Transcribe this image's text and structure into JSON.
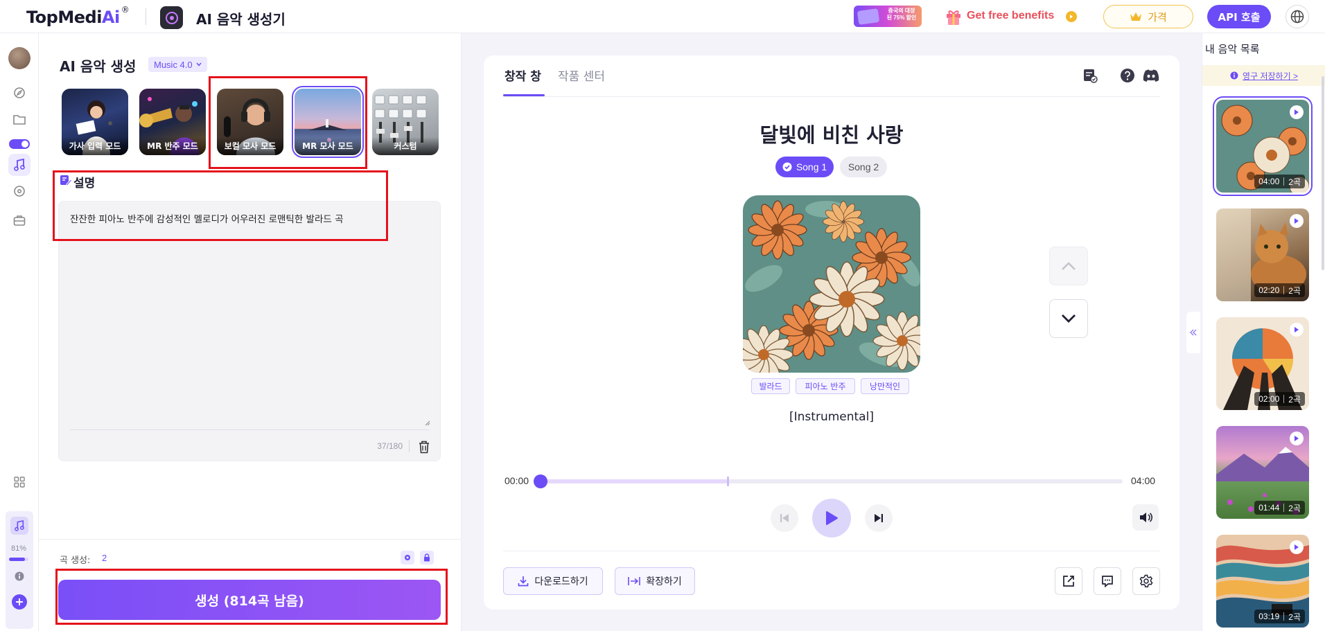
{
  "header": {
    "logo_main": "TopMedi",
    "logo_ai": "Ai",
    "logo_reg": "®",
    "app_title": "AI 음악 생성기",
    "promo_text": "중국의 대장된 75% 할인",
    "free_benefits": "Get free benefits",
    "price_label": "가격",
    "api_label": "API 호출"
  },
  "rail": {
    "percent": "81%"
  },
  "left_panel": {
    "title": "AI 음악 생성",
    "version": "Music 4.0",
    "modes": [
      {
        "label": "가사 입력 모드"
      },
      {
        "label": "MR 반주 모드"
      },
      {
        "label": "보컬 모사 모드"
      },
      {
        "label": "MR 모사 모드"
      },
      {
        "label": "커스텀"
      }
    ],
    "description_title": "설명",
    "description_text": "잔잔한 피아노 반주에 감성적인 멜로디가 어우러진 로맨틱한 발라드 곡",
    "char_count": "37/180",
    "song_count_label": "곡 생성:",
    "song_count_value": "2",
    "generate_label": "생성 (814곡 남음)"
  },
  "player": {
    "tabs": [
      "창작 창",
      "작품 센터"
    ],
    "song_title": "달빛에 비친 사랑",
    "song_chips": [
      "Song 1",
      "Song 2"
    ],
    "tags": [
      "발라드",
      "피아노 반주",
      "낭만적인"
    ],
    "lyrics": "[Instrumental]",
    "time_current": "00:00",
    "time_total": "04:00",
    "download_label": "다운로드하기",
    "extend_label": "확장하기"
  },
  "playlist": {
    "title": "내 음악 목록",
    "banner": "영구 저장하기 >",
    "items": [
      {
        "duration": "04:00",
        "count": "2곡"
      },
      {
        "duration": "02:20",
        "count": "2곡"
      },
      {
        "duration": "02:00",
        "count": "2곡"
      },
      {
        "duration": "01:44",
        "count": "2곡"
      },
      {
        "duration": "03:19",
        "count": "2곡"
      }
    ]
  },
  "colors": {
    "accent": "#6b4cf6",
    "highlight_box": "#e4121b"
  }
}
